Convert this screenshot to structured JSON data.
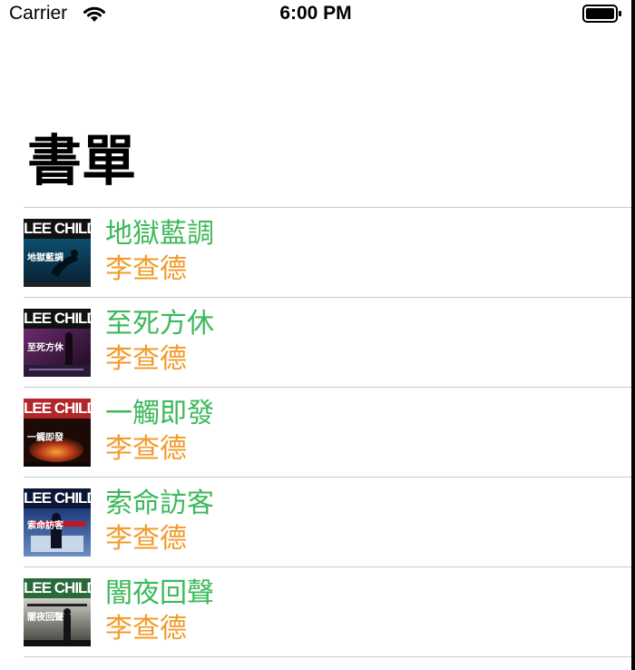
{
  "status_bar": {
    "carrier": "Carrier",
    "time": "6:00 PM",
    "wifi_icon": "wifi-icon",
    "battery_icon": "battery-full-icon"
  },
  "title": "書單",
  "colors": {
    "title_text": "#3cb95a",
    "author_text": "#f29b2a",
    "divider": "#c9c9c9"
  },
  "books": [
    {
      "title": "地獄藍調",
      "author": "李查德",
      "cover_brand": "LEE CHILD",
      "cover_title": "地獄藍調"
    },
    {
      "title": "至死方休",
      "author": "李查德",
      "cover_brand": "LEE CHILD",
      "cover_title": "至死方休"
    },
    {
      "title": "一觸即發",
      "author": "李查德",
      "cover_brand": "LEE CHILD",
      "cover_title": "一觸即發"
    },
    {
      "title": "索命訪客",
      "author": "李查德",
      "cover_brand": "LEE CHILD",
      "cover_title": "索命訪客"
    },
    {
      "title": "闇夜回聲",
      "author": "李查德",
      "cover_brand": "LEE CHILD",
      "cover_title": "闇夜回聲"
    }
  ]
}
